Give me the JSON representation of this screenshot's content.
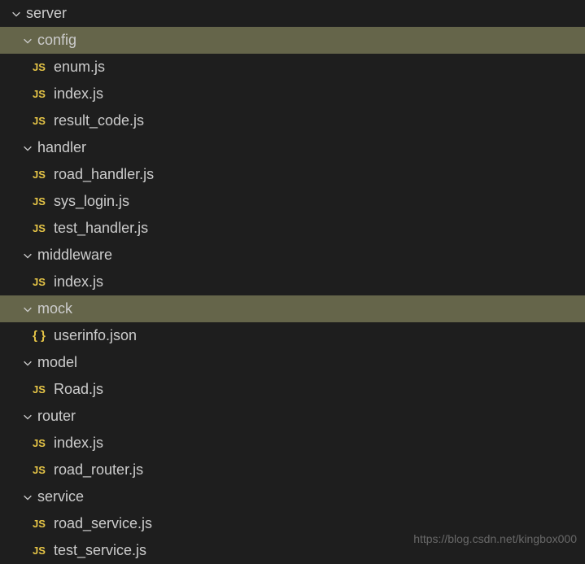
{
  "watermark": "https://blog.csdn.net/kingbox000",
  "tree": [
    {
      "type": "folder",
      "label": "server",
      "indent": 0,
      "expanded": true,
      "selected": false
    },
    {
      "type": "folder",
      "label": "config",
      "indent": 1,
      "expanded": true,
      "selected": true,
      "highlighted": true
    },
    {
      "type": "file",
      "label": "enum.js",
      "indent": 2,
      "icon": "js"
    },
    {
      "type": "file",
      "label": "index.js",
      "indent": 2,
      "icon": "js"
    },
    {
      "type": "file",
      "label": "result_code.js",
      "indent": 2,
      "icon": "js"
    },
    {
      "type": "folder",
      "label": "handler",
      "indent": 1,
      "expanded": true
    },
    {
      "type": "file",
      "label": "road_handler.js",
      "indent": 2,
      "icon": "js"
    },
    {
      "type": "file",
      "label": "sys_login.js",
      "indent": 2,
      "icon": "js"
    },
    {
      "type": "file",
      "label": "test_handler.js",
      "indent": 2,
      "icon": "js"
    },
    {
      "type": "folder",
      "label": "middleware",
      "indent": 1,
      "expanded": true
    },
    {
      "type": "file",
      "label": "index.js",
      "indent": 2,
      "icon": "js"
    },
    {
      "type": "folder",
      "label": "mock",
      "indent": 1,
      "expanded": true,
      "highlighted": true
    },
    {
      "type": "file",
      "label": "userinfo.json",
      "indent": 2,
      "icon": "json"
    },
    {
      "type": "folder",
      "label": "model",
      "indent": 1,
      "expanded": true
    },
    {
      "type": "file",
      "label": "Road.js",
      "indent": 2,
      "icon": "js"
    },
    {
      "type": "folder",
      "label": "router",
      "indent": 1,
      "expanded": true
    },
    {
      "type": "file",
      "label": "index.js",
      "indent": 2,
      "icon": "js"
    },
    {
      "type": "file",
      "label": "road_router.js",
      "indent": 2,
      "icon": "js"
    },
    {
      "type": "folder",
      "label": "service",
      "indent": 1,
      "expanded": true
    },
    {
      "type": "file",
      "label": "road_service.js",
      "indent": 2,
      "icon": "js"
    },
    {
      "type": "file",
      "label": "test_service.js",
      "indent": 2,
      "icon": "js"
    }
  ]
}
